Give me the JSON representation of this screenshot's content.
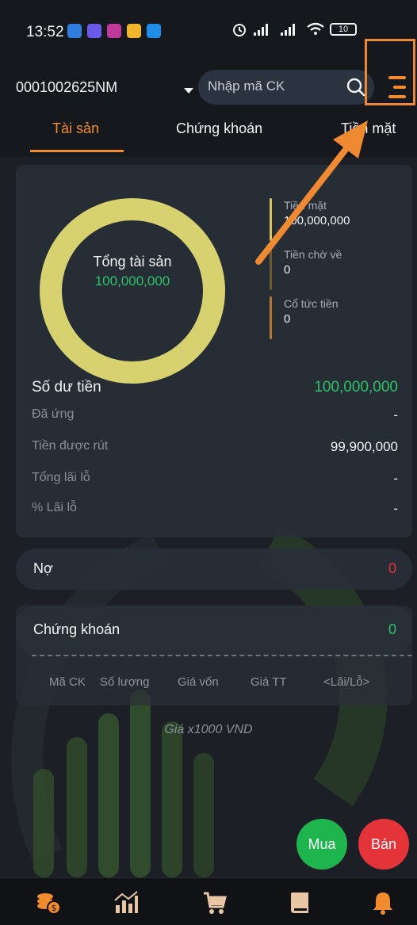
{
  "status_bar": {
    "time": "13:52",
    "battery": "10"
  },
  "header": {
    "account_id": "0001002625NM",
    "search_placeholder": "Nhập mã CK"
  },
  "tabs": [
    {
      "label": "Tài sản",
      "active": true
    },
    {
      "label": "Chứng khoán",
      "active": false
    },
    {
      "label": "Tiền mặt",
      "active": false
    }
  ],
  "overview": {
    "donut_label": "Tổng tài sản",
    "donut_value": "100,000,000",
    "legend": [
      {
        "label": "Tiền mặt",
        "value": "100,000,000"
      },
      {
        "label": "Tiền chờ về",
        "value": "0"
      },
      {
        "label": "Cổ tức tiền",
        "value": "0"
      }
    ]
  },
  "balance": {
    "title": "Số dư tiền",
    "title_value": "100,000,000",
    "rows": [
      {
        "label": "Đã ứng",
        "value": "-"
      },
      {
        "label": "Tiền được rút",
        "value": "99,900,000"
      },
      {
        "label": "Tổng lãi lỗ",
        "value": "-"
      },
      {
        "label": "% Lãi lỗ",
        "value": "-"
      }
    ]
  },
  "debt": {
    "label": "Nợ",
    "value": "0"
  },
  "stocks": {
    "label": "Chứng khoán",
    "value": "0",
    "columns": [
      "Mã CK",
      "Số lượng",
      "Giá vốn",
      "Giá TT",
      "<Lãi/Lỗ>"
    ]
  },
  "note": "Giá x1000 VND",
  "actions": {
    "buy": "Mua",
    "sell": "Bán"
  },
  "colors": {
    "accent": "#f28b2e",
    "positive": "#2ec16a",
    "negative": "#e5333a",
    "donut": "#d8d170"
  },
  "bottom_nav": [
    {
      "icon": "assets-icon",
      "active": true
    },
    {
      "icon": "chart-icon",
      "active": false
    },
    {
      "icon": "cart-icon",
      "active": false
    },
    {
      "icon": "book-icon",
      "active": false
    },
    {
      "icon": "bell-icon",
      "active": false
    }
  ]
}
